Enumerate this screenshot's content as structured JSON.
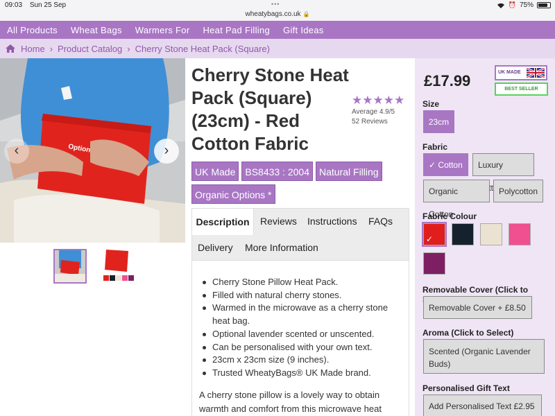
{
  "status_bar": {
    "time": "09:03",
    "date": "Sun 25 Sep",
    "url": "wheatybags.co.uk",
    "battery": "75%"
  },
  "nav": [
    "All Products",
    "Wheat Bags",
    "Warmers For",
    "Heat Pad Filling",
    "Gift Ideas"
  ],
  "breadcrumb": [
    "Home",
    "Product Catalog",
    "Cherry Stone Heat Pack (Square)"
  ],
  "product": {
    "title": "Cherry Stone Heat Pack (Square) (23cm) - Red Cotton Fabric",
    "rating": {
      "stars": "★★★★★",
      "average": "Average 4.9/5",
      "reviews": "52 Reviews"
    },
    "badges": [
      "UK Made",
      "BS8433 : 2004",
      "Natural Filling",
      "Organic Options *"
    ],
    "image_text": "Optional Text"
  },
  "tabs": [
    "Description",
    "Reviews",
    "Instructions",
    "FAQs",
    "Delivery",
    "More Information"
  ],
  "description": {
    "bullets": [
      "Cherry Stone Pillow Heat Pack.",
      "Filled with natural cherry stones.",
      "Warmed in the microwave as a cherry stone heat bag.",
      "Optional lavender scented or unscented.",
      "Can be personalised with your own text.",
      "23cm x 23cm size (9 inches).",
      "Trusted WheatyBags® UK Made brand."
    ],
    "paragraph": "A cherry stone pillow is a lovely way to obtain warmth and comfort from this microwave heat"
  },
  "options": {
    "price": "£17.99",
    "uk_made_badge": "UK MADE",
    "best_seller_badge": "BEST SELLER",
    "size_label": "Size",
    "size_value": "23cm",
    "fabric_label": "Fabric",
    "fabrics": [
      "Cotton",
      "Luxury Cotton",
      "Organic Cotton",
      "Polycotton"
    ],
    "fabric_selected_mark": "✓",
    "colour_label": "Fabric Colour",
    "colours": [
      "#e01e1e",
      "#15222e",
      "#ece2d1",
      "#f0508f",
      "#7e1f63"
    ],
    "cover_label": "Removable Cover (Click to Select)",
    "cover_value": "Removable Cover + £8.50",
    "aroma_label": "Aroma (Click to Select)",
    "aroma_value": "Scented (Organic Lavender Buds)",
    "gift_label": "Personalised Gift Text",
    "gift_value": "Add Personalised Text £2.95"
  },
  "colors": {
    "accent": "#a976c4",
    "panel": "#efe5f5",
    "crumb_bg": "#e6d8ef"
  }
}
